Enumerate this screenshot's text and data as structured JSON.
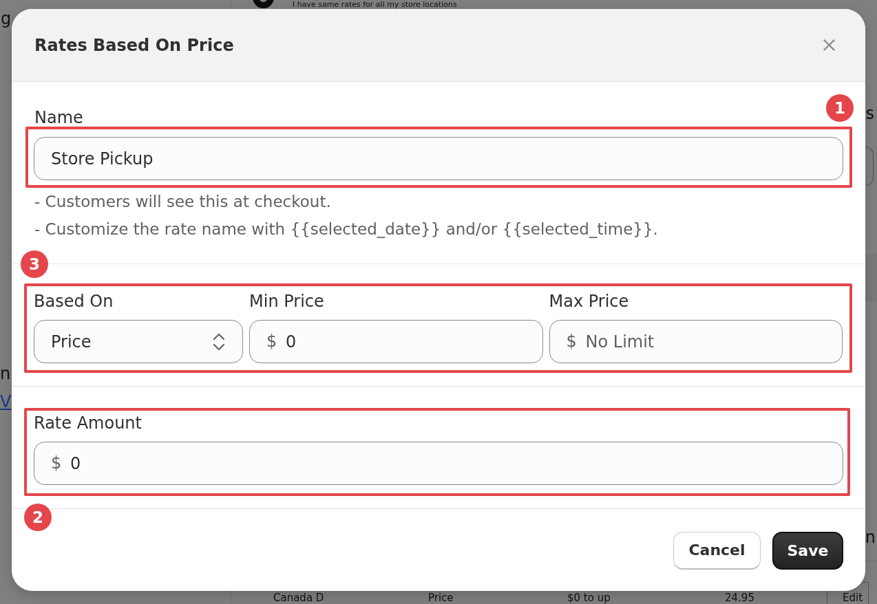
{
  "background": {
    "option": {
      "label": "I have same rates for all my store locations",
      "selected": true
    },
    "left_fragments": [
      "g",
      "n"
    ],
    "left_link": "V",
    "right_fragments": [
      "s",
      "n"
    ],
    "table_row": {
      "cells": [
        "Canada D",
        "Price",
        "$0 to up",
        "24.95"
      ],
      "action": "Edit"
    }
  },
  "dialog": {
    "title": "Rates Based On Price",
    "name": {
      "label": "Name",
      "value": "Store Pickup",
      "badge": "1",
      "hints": [
        "- Customers will see this at checkout.",
        "- Customize the rate name with {{selected_date}} and/or {{selected_time}}."
      ]
    },
    "condition": {
      "badge": "3",
      "fields": [
        {
          "kind": "select",
          "label": "Based On",
          "value": "Price"
        },
        {
          "kind": "currency",
          "label": "Min Price",
          "prefix": "$",
          "value": "0"
        },
        {
          "kind": "currency",
          "label": "Max Price",
          "prefix": "$",
          "placeholder": "No Limit"
        }
      ]
    },
    "rate": {
      "label": "Rate Amount",
      "prefix": "$",
      "value": "0",
      "badge": "2"
    },
    "buttons": [
      {
        "label": "Cancel",
        "kind": "secondary"
      },
      {
        "label": "Save",
        "kind": "primary"
      }
    ]
  }
}
